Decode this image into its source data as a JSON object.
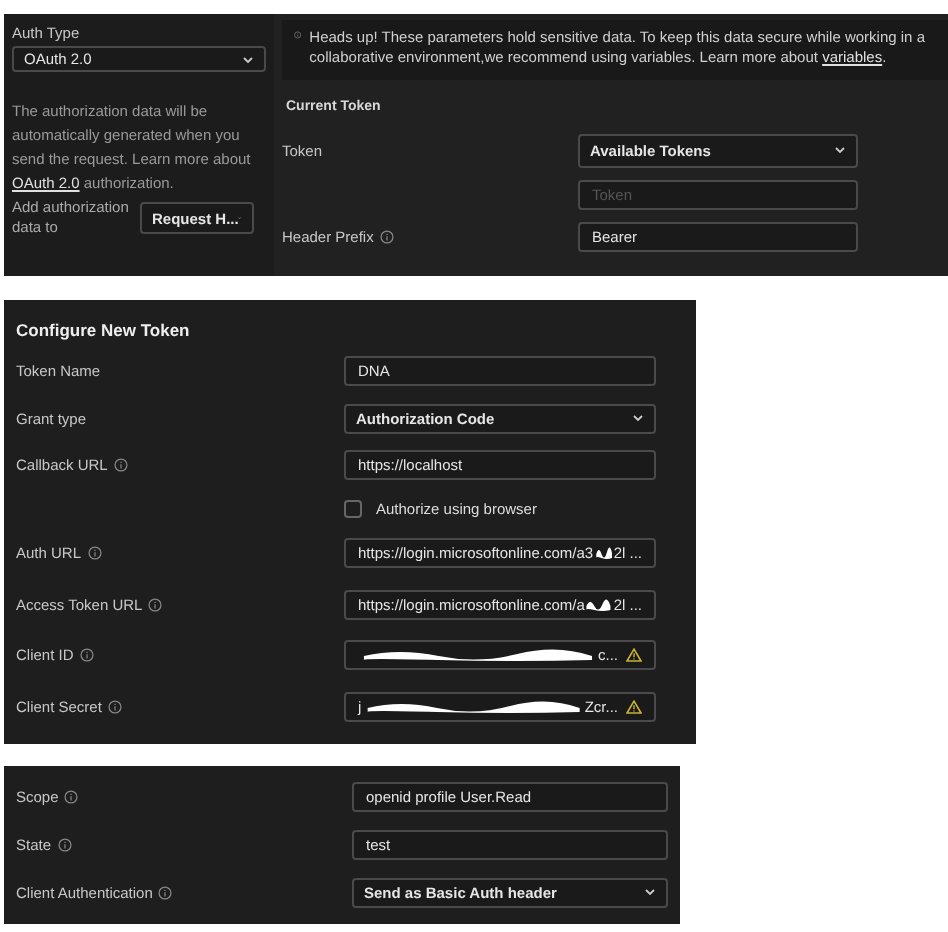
{
  "auth_panel": {
    "auth_type_label": "Auth Type",
    "auth_type": "OAuth 2.0",
    "description_before": "The authorization data will be automatically generated when you send the request. Learn more about ",
    "description_link": "OAuth 2.0",
    "description_after": " authorization.",
    "add_to_label": "Add authorization data to",
    "add_to": "Request H...",
    "notice_before": "Heads up! These parameters hold sensitive data. To keep this data secure while working in a collaborative environment,we recommend using variables. Learn more about ",
    "notice_link": "variables",
    "notice_after": ".",
    "current_token_title": "Current Token",
    "token_label": "Token",
    "token_select": "Available Tokens",
    "token_placeholder": "Token",
    "header_prefix_label": "Header Prefix",
    "header_prefix": "Bearer"
  },
  "configure": {
    "title": "Configure New Token",
    "rows": [
      {
        "kind": "text",
        "label": "Token Name",
        "info": false,
        "value": "DNA"
      },
      {
        "kind": "select",
        "label": "Grant type",
        "info": false,
        "value": "Authorization Code"
      },
      {
        "kind": "text",
        "label": "Callback URL",
        "info": true,
        "value": "https://localhost"
      },
      {
        "kind": "checkbox",
        "label": "Authorize using browser",
        "checked": false
      },
      {
        "kind": "redacted",
        "label": "Auth URL",
        "info": true,
        "value": "https://login.microsoftonline.com/a3",
        "value_end": "2l ...",
        "warning": false
      },
      {
        "kind": "redacted",
        "label": "Access Token URL",
        "info": true,
        "value": "https://login.microsoftonline.com/a",
        "value_end": "2l ...",
        "warning": false
      },
      {
        "kind": "redacted",
        "label": "Client ID",
        "info": true,
        "value": "",
        "value_end": "c...",
        "warning": true
      },
      {
        "kind": "redacted",
        "label": "Client Secret",
        "info": true,
        "value": "j",
        "value_end": "Zcr...",
        "warning": true
      }
    ]
  },
  "extra": {
    "rows": [
      {
        "kind": "text",
        "label": "Scope",
        "info": true,
        "value": "openid profile User.Read"
      },
      {
        "kind": "text",
        "label": "State",
        "info": true,
        "value": "test"
      },
      {
        "kind": "select",
        "label": "Client Authentication",
        "info": true,
        "value": "Send as Basic Auth header"
      }
    ]
  }
}
